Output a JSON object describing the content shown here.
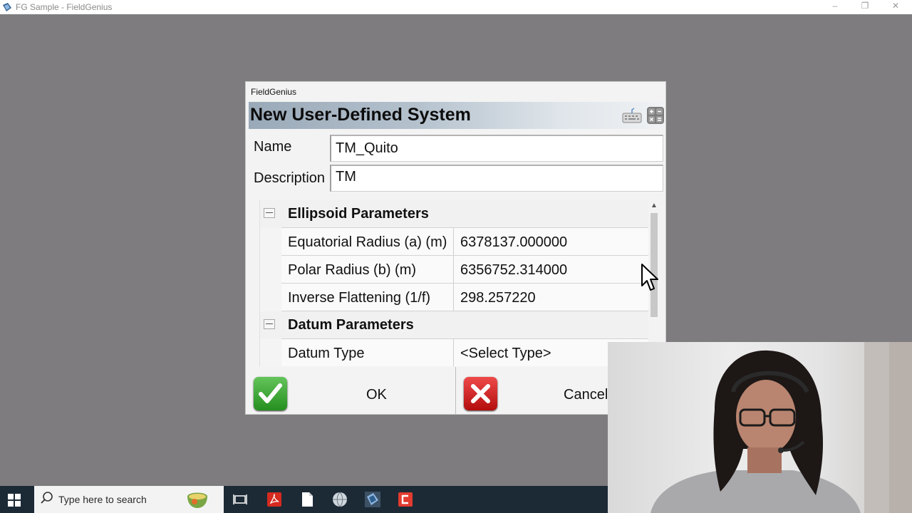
{
  "window": {
    "title": "FG Sample - FieldGenius",
    "minimize_glyph": "–",
    "restore_glyph": "❐",
    "close_glyph": "✕"
  },
  "dialog": {
    "caption": "FieldGenius",
    "title": "New User-Defined System",
    "name_label": "Name",
    "name_value": "TM_Quito",
    "description_label": "Description",
    "description_value": "TM",
    "sections": [
      {
        "title": "Ellipsoid Parameters",
        "rows": [
          {
            "label": "Equatorial Radius (a) (m)",
            "value": "6378137.000000"
          },
          {
            "label": "Polar Radius (b) (m)",
            "value": "6356752.314000"
          },
          {
            "label": "Inverse Flattening (1/f)",
            "value": "298.257220"
          }
        ]
      },
      {
        "title": "Datum Parameters",
        "rows": [
          {
            "label": "Datum Type",
            "value": "<Select Type>"
          }
        ]
      }
    ],
    "ok_label": "OK",
    "cancel_label": "Cancel"
  },
  "taskbar": {
    "search_placeholder": "Type here to search"
  },
  "colors": {
    "accent": "#1c2a36",
    "ok_green": "#2f9a2a",
    "cancel_red": "#d11b1b"
  }
}
